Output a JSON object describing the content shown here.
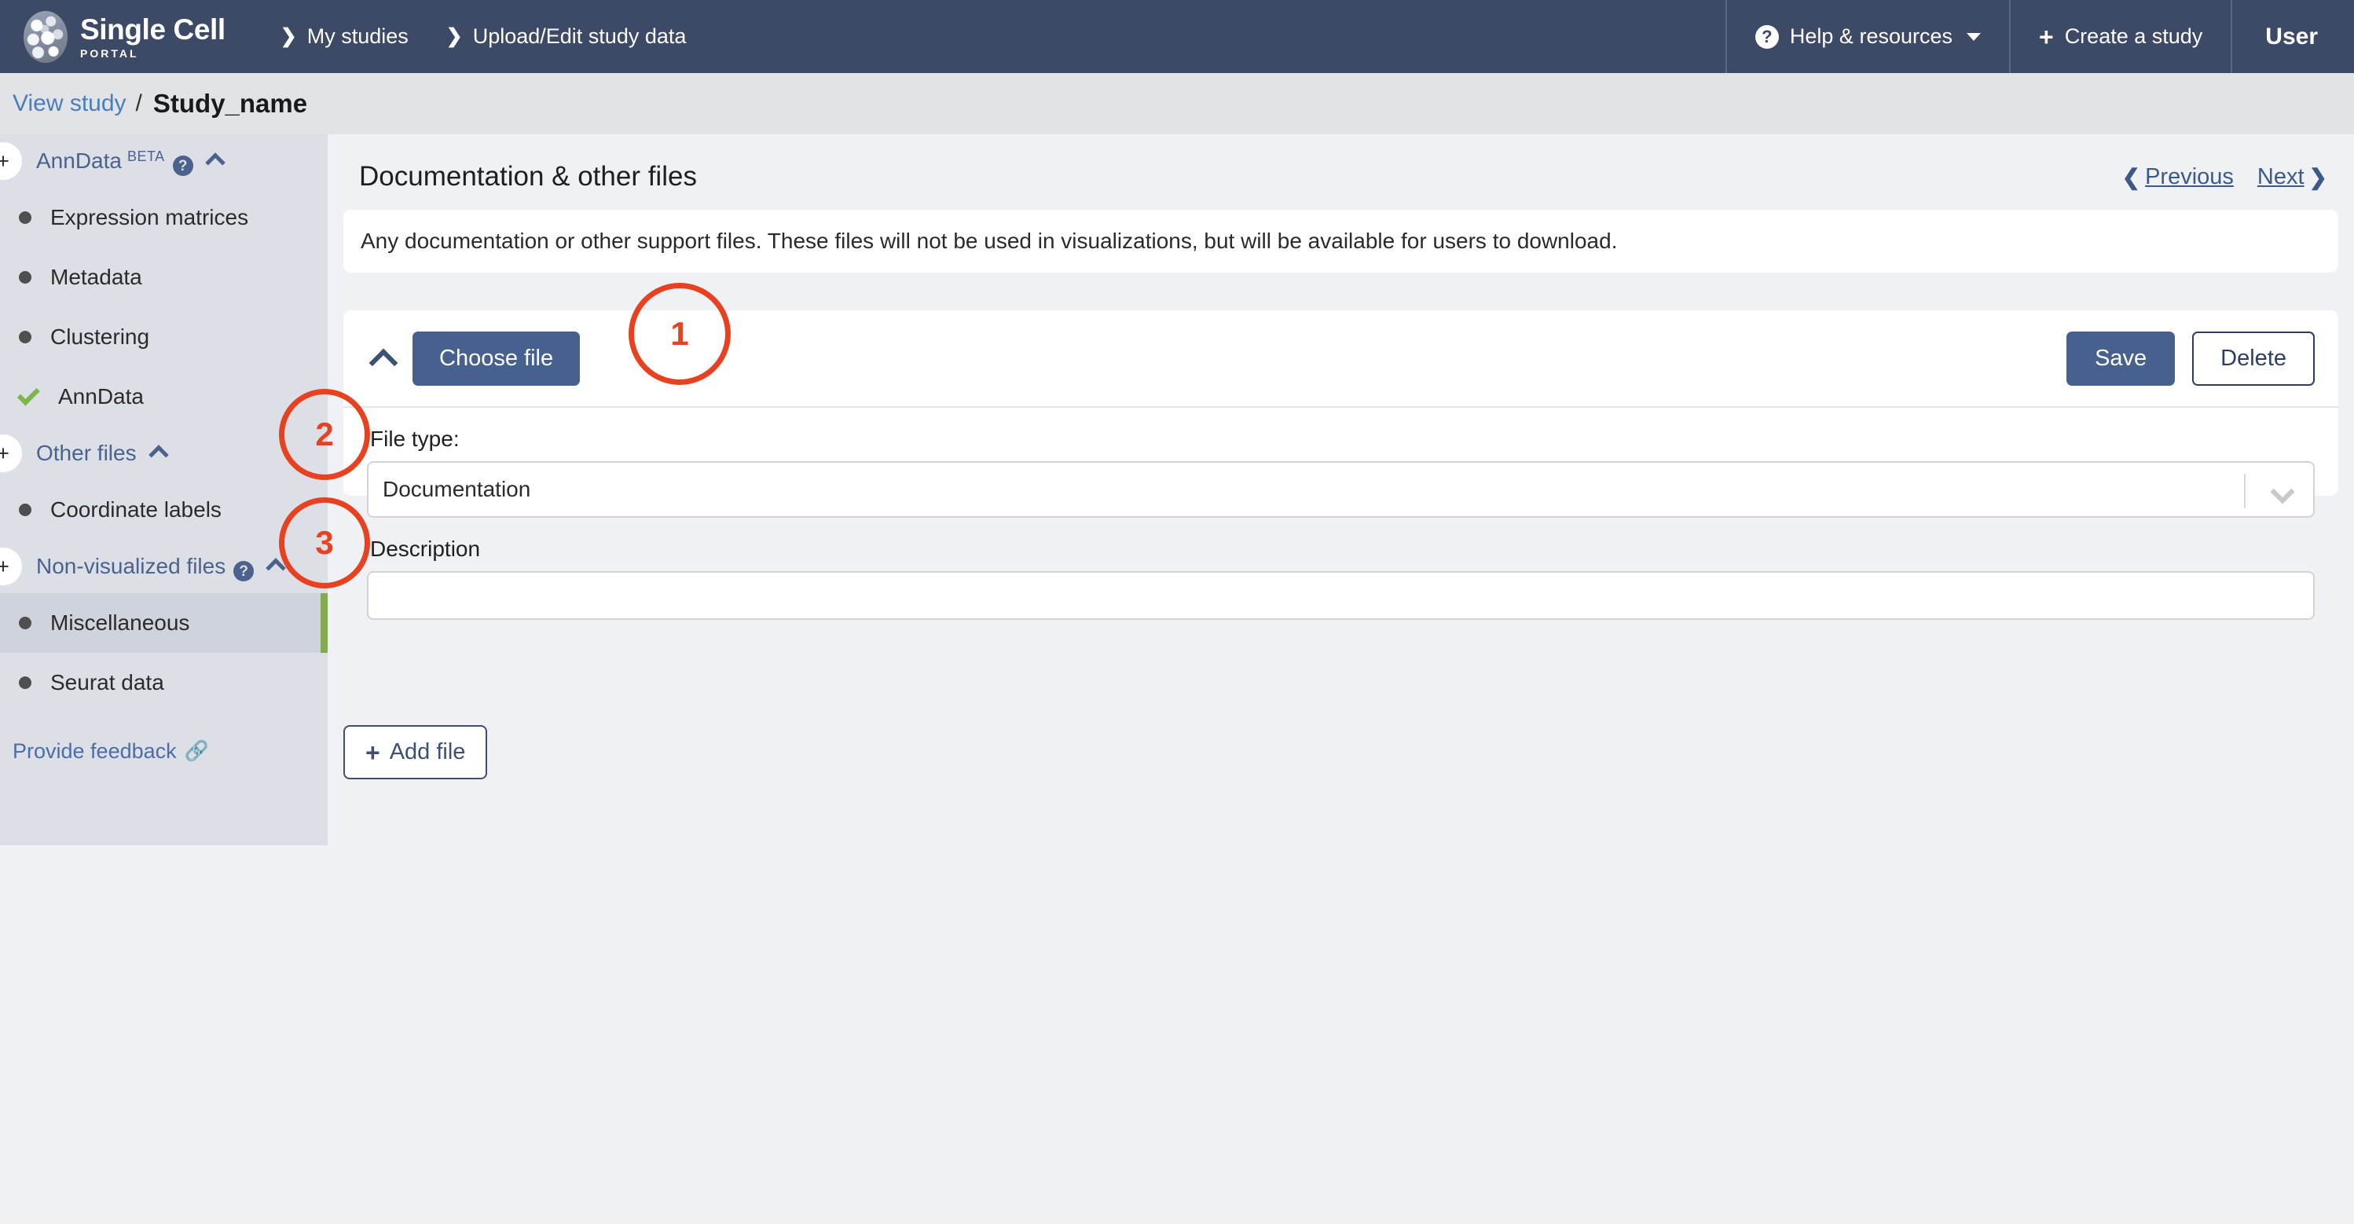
{
  "topnav": {
    "brand_main": "Single Cell",
    "brand_sub": "PORTAL",
    "links": [
      {
        "label": "My studies",
        "icon": "chevron-right-icon"
      },
      {
        "label": "Upload/Edit study data",
        "icon": "chevron-right-icon"
      }
    ],
    "help": {
      "label": "Help & resources",
      "icon": "question-circle-icon",
      "caret": "chevron-down-icon"
    },
    "create_study": {
      "label": "Create a study",
      "icon": "plus-icon"
    },
    "user": {
      "label": "User"
    },
    "background_color": "#3c4a65"
  },
  "studybar": {
    "view_study_label": "View study",
    "separator": "/",
    "study_name": "Study_name"
  },
  "sidebar": {
    "sections": [
      {
        "label": "AnnData",
        "badge": "BETA",
        "has_help": true,
        "collapse_icon": "chevron-up-icon",
        "add_icon": "plus-icon",
        "items": [
          {
            "label": "Expression matrices",
            "status": "bullet"
          },
          {
            "label": "Metadata",
            "status": "bullet"
          },
          {
            "label": "Clustering",
            "status": "bullet"
          },
          {
            "label": "AnnData",
            "status": "check"
          }
        ]
      },
      {
        "label": "Other files",
        "badge": "",
        "has_help": false,
        "collapse_icon": "chevron-up-icon",
        "add_icon": "plus-icon",
        "items": [
          {
            "label": "Coordinate labels",
            "status": "bullet"
          }
        ]
      },
      {
        "label": "Non-visualized files",
        "badge": "",
        "has_help": true,
        "collapse_icon": "chevron-up-icon",
        "add_icon": "plus-icon",
        "items": [
          {
            "label": "Miscellaneous",
            "status": "bullet",
            "active": true
          },
          {
            "label": "Seurat data",
            "status": "bullet"
          }
        ]
      }
    ],
    "feedback": {
      "label": "Provide feedback",
      "icon": "external-link-icon"
    },
    "active_accent_color": "#83ab52"
  },
  "main": {
    "panel_title": "Documentation & other files",
    "pager": {
      "previous_label": "Previous",
      "next_label": "Next",
      "prev_icon": "chevron-left-icon",
      "next_icon": "chevron-right-icon"
    },
    "description": "Any documentation or other support files. These files will not be used in visualizations, but will be available for users to download.",
    "file_card": {
      "collapse_icon": "chevron-up-icon",
      "choose_file_label": "Choose file",
      "save_label": "Save",
      "delete_label": "Delete",
      "file_type_label": "File type:",
      "file_type_value": "Documentation",
      "file_type_caret": "chevron-down-icon",
      "description_label": "Description",
      "description_value": "",
      "description_placeholder": ""
    },
    "add_file": {
      "label": "Add file",
      "icon": "plus-icon"
    }
  },
  "annotations": [
    {
      "number": "1"
    },
    {
      "number": "2"
    },
    {
      "number": "3"
    }
  ]
}
